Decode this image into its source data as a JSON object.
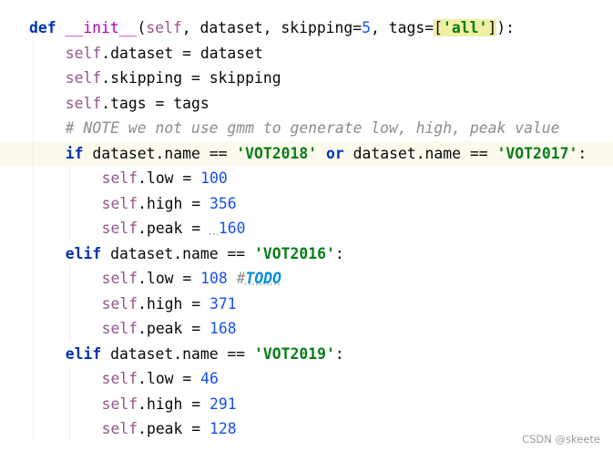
{
  "editor": {
    "top_fragment": "\"\"\"",
    "lines": [
      {
        "indent": 0,
        "current": false,
        "tokens": [
          {
            "t": "def",
            "c": "kw"
          },
          {
            "t": " ",
            "c": "plain"
          },
          {
            "t": "__init__",
            "c": "fn"
          },
          {
            "t": "(",
            "c": "plain"
          },
          {
            "t": "self",
            "c": "self"
          },
          {
            "t": ", dataset, skipping=",
            "c": "plain"
          },
          {
            "t": "5",
            "c": "num"
          },
          {
            "t": ", tags=",
            "c": "plain"
          },
          {
            "t": "[",
            "c": "bracket-hl"
          },
          {
            "t": "'all'",
            "c": "str str-in-hl"
          },
          {
            "t": "]",
            "c": "bracket-hl"
          },
          {
            "t": "):",
            "c": "plain"
          }
        ]
      },
      {
        "indent": 1,
        "current": false,
        "tokens": [
          {
            "t": "self",
            "c": "self"
          },
          {
            "t": ".dataset = dataset",
            "c": "plain"
          }
        ]
      },
      {
        "indent": 1,
        "current": false,
        "tokens": [
          {
            "t": "self",
            "c": "self"
          },
          {
            "t": ".skipping = skipping",
            "c": "plain"
          }
        ]
      },
      {
        "indent": 1,
        "current": false,
        "tokens": [
          {
            "t": "self",
            "c": "self"
          },
          {
            "t": ".tags = tags",
            "c": "plain"
          }
        ]
      },
      {
        "indent": 1,
        "current": false,
        "tokens": [
          {
            "t": "# NOTE we not use gmm to generate low, high, peak value",
            "c": "cmt"
          }
        ]
      },
      {
        "indent": 1,
        "current": true,
        "tokens": [
          {
            "t": "if",
            "c": "kw"
          },
          {
            "t": " dataset.name == ",
            "c": "plain"
          },
          {
            "t": "'VOT2018'",
            "c": "str"
          },
          {
            "t": " ",
            "c": "plain"
          },
          {
            "t": "or",
            "c": "kw"
          },
          {
            "t": " dataset.name == ",
            "c": "plain"
          },
          {
            "t": "'VOT2017'",
            "c": "str"
          },
          {
            "t": ":",
            "c": "plain"
          }
        ]
      },
      {
        "indent": 2,
        "current": false,
        "tokens": [
          {
            "t": "self",
            "c": "self"
          },
          {
            "t": ".low = ",
            "c": "plain"
          },
          {
            "t": "100",
            "c": "num"
          }
        ]
      },
      {
        "indent": 2,
        "current": false,
        "tokens": [
          {
            "t": "self",
            "c": "self"
          },
          {
            "t": ".high = ",
            "c": "plain"
          },
          {
            "t": "356",
            "c": "num"
          }
        ]
      },
      {
        "indent": 2,
        "current": false,
        "tokens": [
          {
            "t": "self",
            "c": "self"
          },
          {
            "t": ".peak = ",
            "c": "plain"
          },
          {
            "t": " ",
            "c": "plain squiggle"
          },
          {
            "t": "160",
            "c": "num"
          }
        ]
      },
      {
        "indent": 1,
        "current": false,
        "tokens": [
          {
            "t": "elif",
            "c": "kw"
          },
          {
            "t": " dataset.name == ",
            "c": "plain"
          },
          {
            "t": "'VOT2016'",
            "c": "str"
          },
          {
            "t": ":",
            "c": "plain"
          }
        ]
      },
      {
        "indent": 2,
        "current": false,
        "tokens": [
          {
            "t": "self",
            "c": "self"
          },
          {
            "t": ".low = ",
            "c": "plain"
          },
          {
            "t": "108",
            "c": "num"
          },
          {
            "t": " ",
            "c": "plain"
          },
          {
            "t": "#",
            "c": "cmt"
          },
          {
            "t": "TODO",
            "c": "todo squiggle"
          }
        ]
      },
      {
        "indent": 2,
        "current": false,
        "tokens": [
          {
            "t": "self",
            "c": "self"
          },
          {
            "t": ".high = ",
            "c": "plain"
          },
          {
            "t": "371",
            "c": "num"
          }
        ]
      },
      {
        "indent": 2,
        "current": false,
        "tokens": [
          {
            "t": "self",
            "c": "self"
          },
          {
            "t": ".peak = ",
            "c": "plain"
          },
          {
            "t": "168",
            "c": "num"
          }
        ]
      },
      {
        "indent": 1,
        "current": false,
        "tokens": [
          {
            "t": "elif",
            "c": "kw"
          },
          {
            "t": " dataset.name == ",
            "c": "plain"
          },
          {
            "t": "'VOT2019'",
            "c": "str"
          },
          {
            "t": ":",
            "c": "plain"
          }
        ]
      },
      {
        "indent": 2,
        "current": false,
        "tokens": [
          {
            "t": "self",
            "c": "self"
          },
          {
            "t": ".low = ",
            "c": "plain"
          },
          {
            "t": "46",
            "c": "num"
          }
        ]
      },
      {
        "indent": 2,
        "current": false,
        "tokens": [
          {
            "t": "self",
            "c": "self"
          },
          {
            "t": ".high = ",
            "c": "plain"
          },
          {
            "t": "291",
            "c": "num"
          }
        ]
      },
      {
        "indent": 2,
        "current": false,
        "tokens": [
          {
            "t": "self",
            "c": "self"
          },
          {
            "t": ".peak = ",
            "c": "plain"
          },
          {
            "t": "128",
            "c": "num"
          }
        ]
      }
    ]
  },
  "colors": {
    "background": "#ffffff",
    "current_line": "#fcfaed",
    "keyword": "#0033b3",
    "self": "#94558d",
    "function_name": "#b200b2",
    "number": "#1750eb",
    "string": "#067d17",
    "comment": "#8c8c8c",
    "todo": "#008dde"
  },
  "watermark": {
    "text": "CSDN @skeete"
  }
}
